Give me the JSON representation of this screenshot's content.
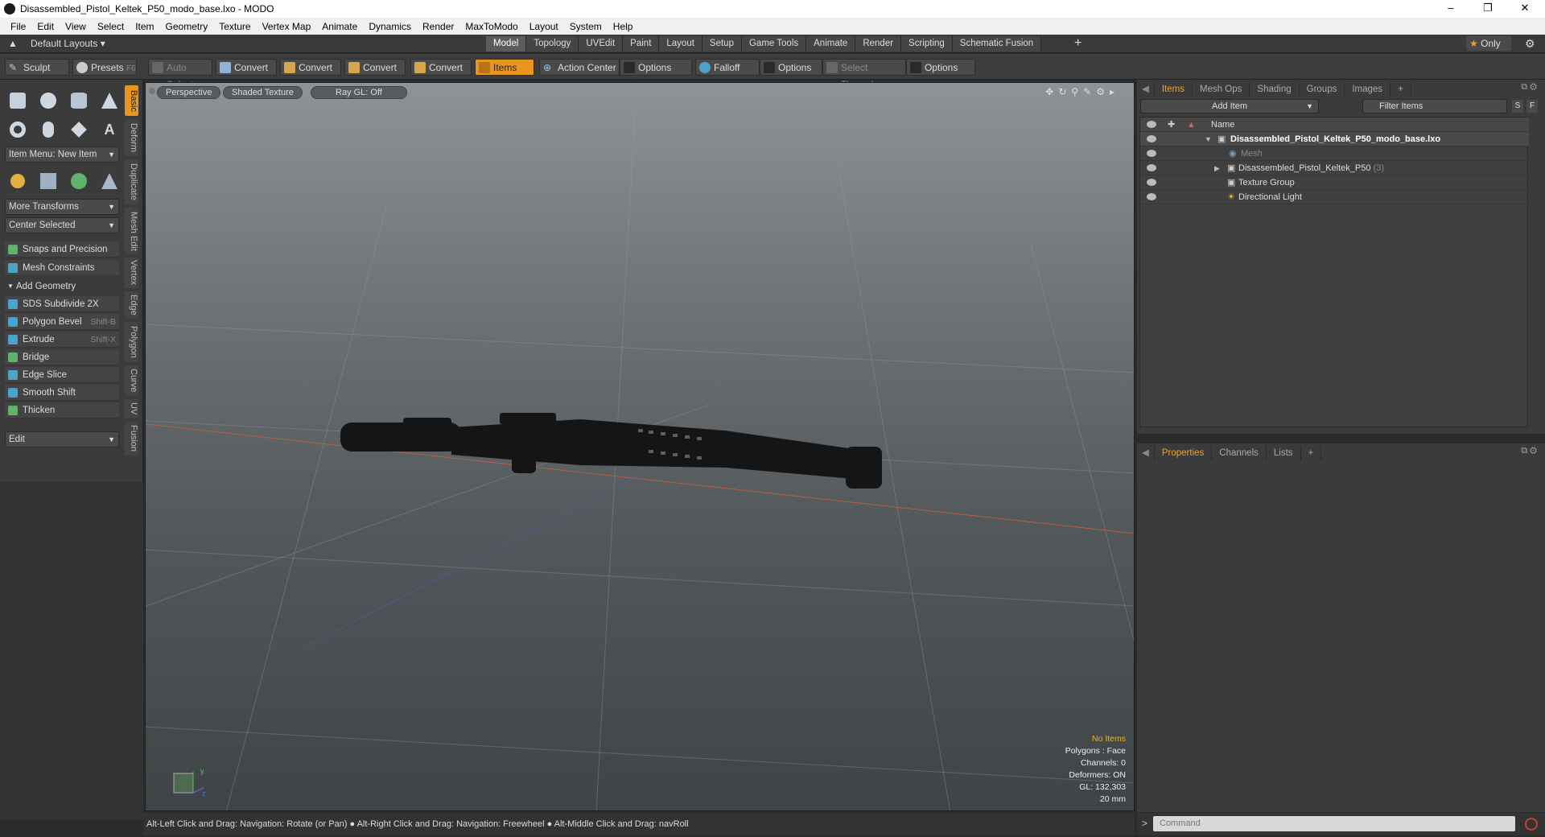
{
  "window": {
    "title": "Disassembled_Pistol_Keltek_P50_modo_base.lxo - MODO"
  },
  "menu": [
    "File",
    "Edit",
    "View",
    "Select",
    "Item",
    "Geometry",
    "Texture",
    "Vertex Map",
    "Animate",
    "Dynamics",
    "Render",
    "MaxToModo",
    "Layout",
    "System",
    "Help"
  ],
  "layoutbar": {
    "layouts": "Default Layouts",
    "tabs": [
      "Model",
      "Topology",
      "UVEdit",
      "Paint",
      "Layout",
      "Setup",
      "Game Tools",
      "Animate",
      "Render",
      "Scripting",
      "Schematic Fusion"
    ],
    "active_tab": "Model",
    "add": "+",
    "only": "Only"
  },
  "toolbar": {
    "sculpt": "Sculpt",
    "presets": "Presets",
    "presets_key": "F6",
    "auto_select": "Auto Select",
    "convert": "Convert",
    "items": "Items",
    "action_center": "Action Center",
    "options": "Options",
    "falloff": "Falloff",
    "select_through": "Select Through"
  },
  "left": {
    "vtabs": [
      "Basic",
      "Deform",
      "Duplicate",
      "Mesh Edit",
      "Vertex",
      "Edge",
      "Polygon",
      "Curve",
      "UV",
      "Fusion"
    ],
    "item_menu": "Item Menu: New Item",
    "more_transforms": "More Transforms",
    "center_selected": "Center Selected",
    "snaps": "Snaps and Precision",
    "mesh_constraints": "Mesh Constraints",
    "add_geometry": "Add Geometry",
    "tools": [
      {
        "label": "SDS Subdivide 2X",
        "shortcut": ""
      },
      {
        "label": "Polygon Bevel",
        "shortcut": "Shift-B"
      },
      {
        "label": "Extrude",
        "shortcut": "Shift-X"
      },
      {
        "label": "Bridge",
        "shortcut": ""
      },
      {
        "label": "Edge Slice",
        "shortcut": ""
      },
      {
        "label": "Smooth Shift",
        "shortcut": ""
      },
      {
        "label": "Thicken",
        "shortcut": ""
      }
    ],
    "edit": "Edit"
  },
  "viewport": {
    "perspective": "Perspective",
    "shading": "Shaded Texture",
    "raygl": "Ray GL: Off",
    "info": {
      "no_items": "No Items",
      "polygons": "Polygons : Face",
      "channels": "Channels: 0",
      "deformers": "Deformers: ON",
      "gl": "GL: 132,303",
      "unit": "20 mm"
    }
  },
  "status": "Alt-Left Click and Drag: Navigation: Rotate (or Pan) ●  Alt-Right Click and Drag: Navigation: Freewheel ●  Alt-Middle Click and Drag: navRoll",
  "items_panel": {
    "tabs": [
      "Items",
      "Mesh Ops",
      "Shading",
      "Groups",
      "Images",
      "+"
    ],
    "add_item": "Add Item",
    "filter": "Filter Items",
    "s": "S",
    "f": "F",
    "name_header": "Name",
    "rows": [
      {
        "label": "Disassembled_Pistol_Keltek_P50_modo_base.lxo",
        "count": ""
      },
      {
        "label": "Mesh",
        "count": ""
      },
      {
        "label": "Disassembled_Pistol_Keltek_P50",
        "count": "(3)"
      },
      {
        "label": "Texture Group",
        "count": ""
      },
      {
        "label": "Directional Light",
        "count": ""
      }
    ]
  },
  "props_panel": {
    "tabs": [
      "Properties",
      "Channels",
      "Lists",
      "+"
    ]
  },
  "command": {
    "placeholder": "Command",
    "prompt": ">"
  }
}
